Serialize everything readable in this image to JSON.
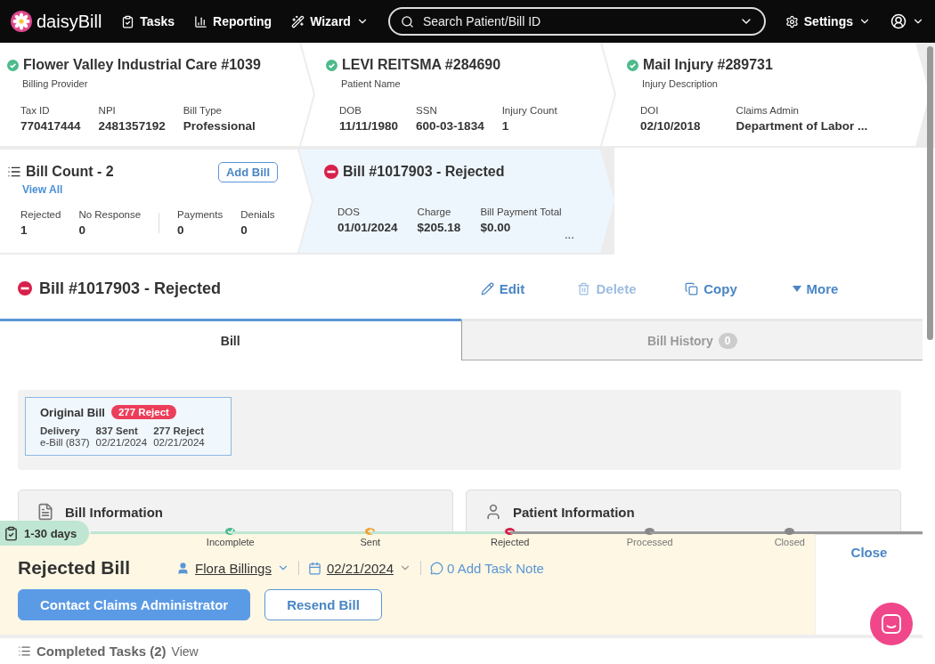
{
  "nav": {
    "logo": "daisyBill",
    "items": [
      {
        "label": "Tasks",
        "dropdown": false
      },
      {
        "label": "Reporting",
        "dropdown": false
      },
      {
        "label": "Wizard",
        "dropdown": true
      }
    ],
    "search": {
      "placeholder": "Search Patient/Bill ID"
    },
    "settings": "Settings"
  },
  "summary_cards": [
    {
      "title": "Flower Valley Industrial Care #1039",
      "verified": true,
      "subtitle": "Billing Provider",
      "fields": [
        {
          "label": "Tax ID",
          "value": "770417444"
        },
        {
          "label": "NPI",
          "value": "2481357192"
        },
        {
          "label": "Bill Type",
          "value": "Professional"
        }
      ]
    },
    {
      "title": "LEVI REITSMA #284690",
      "verified": true,
      "subtitle": "Patient Name",
      "fields": [
        {
          "label": "DOB",
          "value": "11/11/1980"
        },
        {
          "label": "SSN",
          "value": "600-03-1834"
        },
        {
          "label": "Injury Count",
          "value": "1"
        }
      ]
    },
    {
      "title": "Mail Injury #289731",
      "verified": true,
      "subtitle": "Injury Description",
      "fields": [
        {
          "label": "DOI",
          "value": "02/10/2018"
        },
        {
          "label": "Claims Admin",
          "value": "Department of Labor ..."
        }
      ]
    }
  ],
  "bill_count": {
    "title": "Bill Count - 2",
    "link": "View All",
    "button": "Add Bill",
    "groups": [
      [
        {
          "label": "Rejected",
          "value": "1"
        },
        {
          "label": "No Response",
          "value": "0"
        }
      ],
      [
        {
          "label": "Payments",
          "value": "0"
        },
        {
          "label": "Denials",
          "value": "0"
        }
      ]
    ]
  },
  "selected_bill": {
    "title": "Bill #1017903 - Rejected",
    "fields": [
      {
        "label": "DOS",
        "value": "01/01/2024"
      },
      {
        "label": "Charge",
        "value": "$205.18"
      },
      {
        "label": "Bill Payment Total",
        "value": "$0.00"
      }
    ],
    "more": "..."
  },
  "bill_header": {
    "title": "Bill #1017903 - Rejected",
    "actions": [
      {
        "label": "Edit",
        "disabled": false
      },
      {
        "label": "Delete",
        "disabled": true
      },
      {
        "label": "Copy",
        "disabled": false
      },
      {
        "label": "More",
        "disabled": false
      }
    ]
  },
  "tabs": [
    {
      "label": "Bill",
      "selected": true
    },
    {
      "label": "Bill History",
      "badge": "0",
      "selected": false
    }
  ],
  "original_bill": {
    "title": "Original Bill",
    "badge": "277 Reject",
    "columns": [
      {
        "label": "Delivery",
        "value": "e-Bill (837)"
      },
      {
        "label": "837 Sent",
        "value": "02/21/2024"
      },
      {
        "label": "277 Reject",
        "value": "02/21/2024"
      }
    ]
  },
  "sections": [
    {
      "title": "Bill Information"
    },
    {
      "title": "Patient Information"
    }
  ],
  "task": {
    "age": "1-30 days",
    "steps": [
      {
        "label": "Incomplete",
        "kind": "done"
      },
      {
        "label": "Sent",
        "kind": "sent"
      },
      {
        "label": "Rejected",
        "kind": "rejected"
      },
      {
        "label": "Processed",
        "kind": "pending"
      },
      {
        "label": "Closed",
        "kind": "pending"
      }
    ],
    "title": "Rejected Bill",
    "assignee": "Flora Billings",
    "date": "02/21/2024",
    "note": "0 Add Task Note",
    "buttons": [
      {
        "label": "Contact Claims Administrator",
        "primary": true
      },
      {
        "label": "Resend Bill",
        "primary": false
      }
    ],
    "close": "Close"
  },
  "completed": {
    "label": "Completed Tasks (2)",
    "link": "View"
  }
}
